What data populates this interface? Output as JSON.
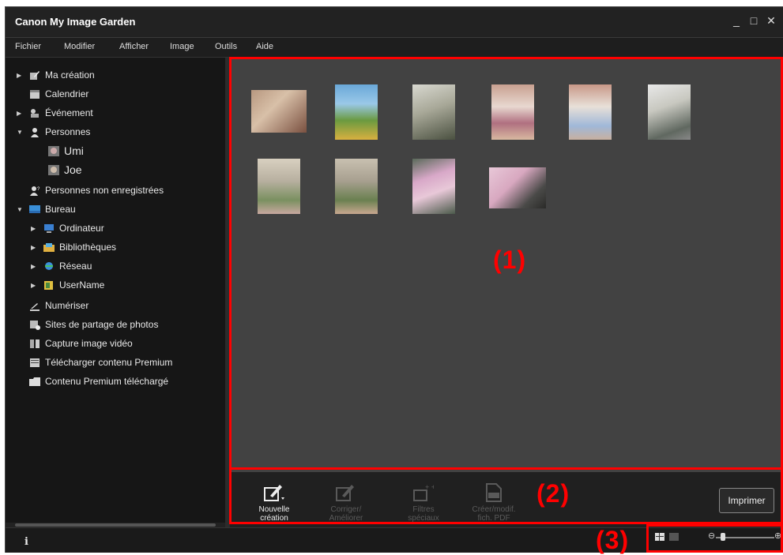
{
  "window": {
    "title": "Canon My Image Garden",
    "minimize": "_",
    "maximize": "□",
    "close": "✕"
  },
  "menu": [
    "Fichier",
    "Modifier",
    "Afficher",
    "Image",
    "Outils",
    "Aide"
  ],
  "sidebar": {
    "items": [
      {
        "label": "Ma création",
        "icon": "creation-icon"
      },
      {
        "label": "Calendrier",
        "icon": "calendar-icon"
      },
      {
        "label": "Événement",
        "icon": "event-icon"
      },
      {
        "label": "Personnes",
        "icon": "person-icon"
      },
      {
        "label": "Umi",
        "icon": "face-icon"
      },
      {
        "label": "Joe",
        "icon": "face-icon"
      },
      {
        "label": "Personnes non enregistrées",
        "icon": "unregistered-person-icon"
      },
      {
        "label": "Bureau",
        "icon": "desktop-icon"
      },
      {
        "label": "Ordinateur",
        "icon": "computer-icon"
      },
      {
        "label": "Bibliothèques",
        "icon": "libraries-icon"
      },
      {
        "label": "Réseau",
        "icon": "network-icon"
      },
      {
        "label": "UserName",
        "icon": "user-folder-icon"
      },
      {
        "label": "Numériser",
        "icon": "scan-icon"
      },
      {
        "label": "Sites de partage de photos",
        "icon": "photo-sharing-icon"
      },
      {
        "label": "Capture image vidéo",
        "icon": "video-capture-icon"
      },
      {
        "label": "Télécharger contenu Premium",
        "icon": "download-premium-icon"
      },
      {
        "label": "Contenu Premium téléchargé",
        "icon": "downloaded-premium-icon"
      }
    ]
  },
  "toolbar": {
    "buttons": [
      {
        "label": "Nouvelle création",
        "icon": "new-creation-icon",
        "enabled": true
      },
      {
        "label": "Corriger/ Améliorer",
        "icon": "correct-enhance-icon",
        "enabled": false
      },
      {
        "label": "Filtres spéciaux",
        "icon": "special-filters-icon",
        "enabled": false
      },
      {
        "label": "Créer/modif. fich. PDF",
        "icon": "pdf-icon",
        "enabled": false
      }
    ],
    "print_label": "Imprimer"
  },
  "status": {
    "info_icon": "i"
  },
  "callouts": [
    "(1)",
    "(2)",
    "(3)"
  ],
  "colors": {
    "highlight": "#ff0000",
    "panel": "#424242",
    "background": "#1b1b1b"
  }
}
